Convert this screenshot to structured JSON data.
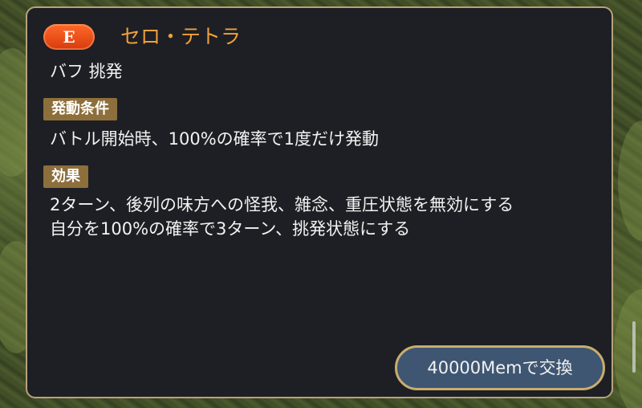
{
  "skill": {
    "rank_badge": "E",
    "name": "セロ・テトラ",
    "tags": "バフ 挑発"
  },
  "sections": [
    {
      "label": "発動条件",
      "lines": [
        "バトル開始時、100%の確率で1度だけ発動"
      ]
    },
    {
      "label": "効果",
      "lines": [
        "2ターン、後列の味方への怪我、雑念、重圧状態を無効にする",
        "自分を100%の確率で3ターン、挑発状態にする"
      ]
    }
  ],
  "exchange_button": {
    "label": "40000Memで交換"
  }
}
